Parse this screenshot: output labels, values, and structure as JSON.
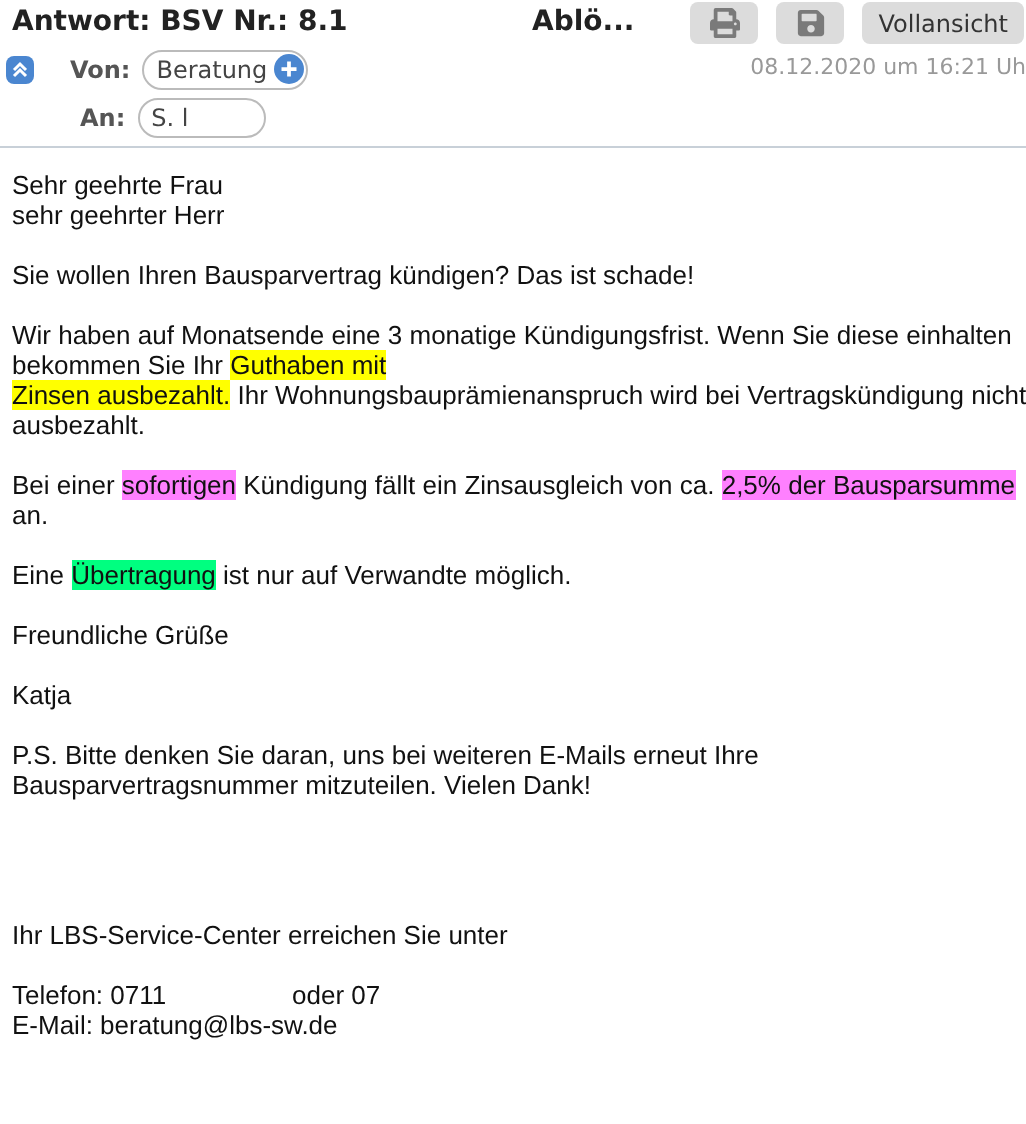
{
  "header": {
    "title": "Antwort: BSV Nr.: 8.1",
    "title_tail": "Ablö...",
    "buttons": [
      {
        "kind": "print"
      },
      {
        "kind": "save"
      },
      {
        "kind": "text",
        "label": "Vollansicht"
      }
    ],
    "from_label": "Von:",
    "from": "Beratung",
    "to_label": "An:",
    "to": "S. l",
    "date": "08.12.2020 um 16:21 Uh"
  },
  "body": [
    {
      "lines": [
        [
          {
            "text": "Sehr geehrte Frau"
          }
        ],
        [
          {
            "text": "sehr geehrter Herr"
          }
        ]
      ]
    },
    {
      "lines": [
        [
          {
            "text": "Sie wollen Ihren Bausparvertrag kündigen? Das ist schade!"
          }
        ]
      ]
    },
    {
      "lines": [
        [
          {
            "text": "Wir haben auf Monatsende eine 3 monatige Kündigungsfrist. Wenn Sie diese einhalten"
          }
        ],
        [
          {
            "text": "bekommen Sie Ihr "
          },
          {
            "text": "Guthaben mit ",
            "color": "#ffff00"
          }
        ],
        [
          {
            "text": "Zinsen ausbezahlt.",
            "color": "#ffff00"
          },
          {
            "text": " Ihr Wohnungsbauprämienanspruch wird bei Vertragskündigung nicht"
          }
        ],
        [
          {
            "text": "ausbezahlt."
          }
        ]
      ]
    },
    {
      "lines": [
        [
          {
            "text": "Bei einer "
          },
          {
            "text": "sofortigen",
            "color": "#ff80ff"
          },
          {
            "text": " Kündigung fällt ein Zinsausgleich von ca. "
          },
          {
            "text": "2,5% der Bausparsumme",
            "color": "#ff80ff"
          }
        ],
        [
          {
            "text": "an."
          }
        ]
      ]
    },
    {
      "lines": [
        [
          {
            "text": "Eine "
          },
          {
            "text": "Übertragung",
            "color": "#00ff80"
          },
          {
            "text": " ist nur auf Verwandte möglich."
          }
        ]
      ]
    },
    {
      "lines": [
        [
          {
            "text": "Freundliche Grüße"
          }
        ]
      ]
    },
    {
      "lines": [
        [
          {
            "text": "Katja"
          }
        ]
      ]
    },
    {
      "lines": [
        [
          {
            "text": "P.S. Bitte denken Sie daran, uns bei weiteren E-Mails erneut Ihre"
          }
        ],
        [
          {
            "text": "Bausparvertragsnummer mitzuteilen. Vielen Dank!"
          }
        ]
      ]
    }
  ],
  "footer": {
    "intro": "Ihr LBS-Service-Center erreichen Sie unter",
    "phone": "Telefon:  0711",
    "phone_alt": "oder  07",
    "email": "E-Mail: beratung@lbs-sw.de"
  }
}
